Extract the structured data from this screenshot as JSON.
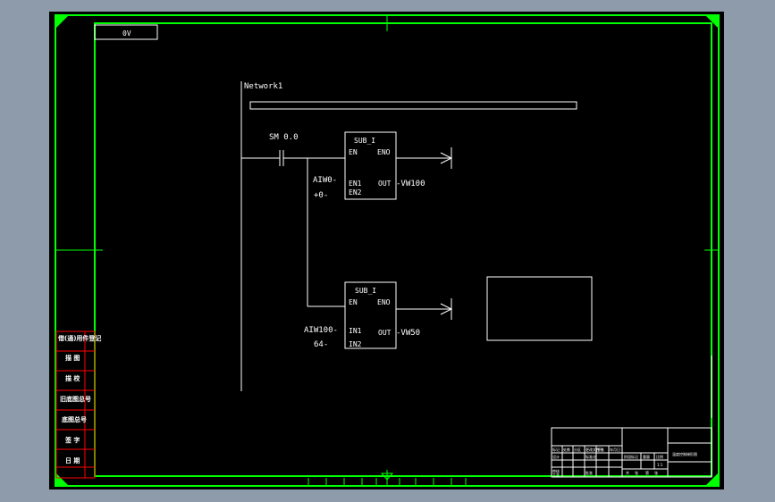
{
  "colors": {
    "frame": "#00ff00",
    "lines": "#ffffff",
    "side_labels": "#ff0000",
    "background": "#000000",
    "window": "#8e9bab"
  },
  "drawing": {
    "corner_tag": "0V",
    "network_label": "Network1",
    "contact_label": "SM 0.0",
    "block1": {
      "title": "SUB_I",
      "pin_en": "EN",
      "pin_eno": "ENO",
      "pin_in1": "EN1",
      "pin_in2": "EN2",
      "pin_out": "OUT",
      "input1": "AIW0-",
      "input2": "+0-",
      "output": "-VW100"
    },
    "block2": {
      "title": "SUB_I",
      "pin_en": "EN",
      "pin_eno": "ENO",
      "pin_in1": "IN1",
      "pin_in2": "IN2",
      "pin_out": "OUT",
      "input1": "AIW100-",
      "input2": "64-",
      "output": "-VW50"
    }
  },
  "side_panel": {
    "labels": [
      "借(通)用件登记",
      "描 图",
      "描 校",
      "旧底图总号",
      "底图总号",
      "签 字",
      "日 期"
    ]
  },
  "title_block": {
    "drawing_title": "温度控制梯形图",
    "cells": [
      "标记",
      "处数",
      "分区",
      "更改文件号",
      "签名",
      "年月日",
      "设计",
      "标准化",
      "阶段标记",
      "重量",
      "比例",
      "审核",
      "工艺",
      "批准",
      "共",
      "张",
      "第",
      "张",
      "1:1"
    ]
  }
}
